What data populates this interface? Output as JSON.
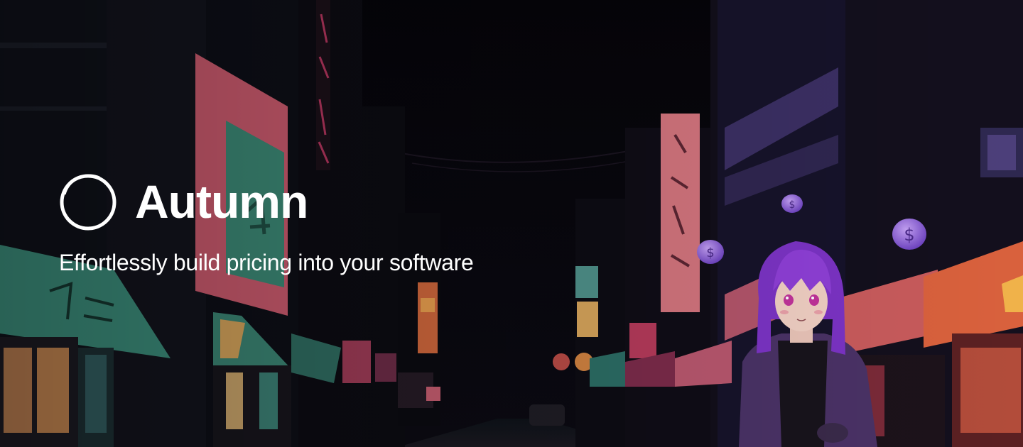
{
  "brand": {
    "name": "Autumn",
    "logo_icon": "ring-logo-icon",
    "tagline": "Effortlessly build pricing into your software"
  },
  "background": {
    "scene": "night-city-street-icon",
    "colors": {
      "sky": "#07060b",
      "sign_pink": "#d86c80",
      "sign_teal": "#3c8b7b",
      "awning_orange": "#d8633d",
      "coin_purple": "#8a5cd6",
      "hair_purple": "#8b3fd0"
    }
  }
}
